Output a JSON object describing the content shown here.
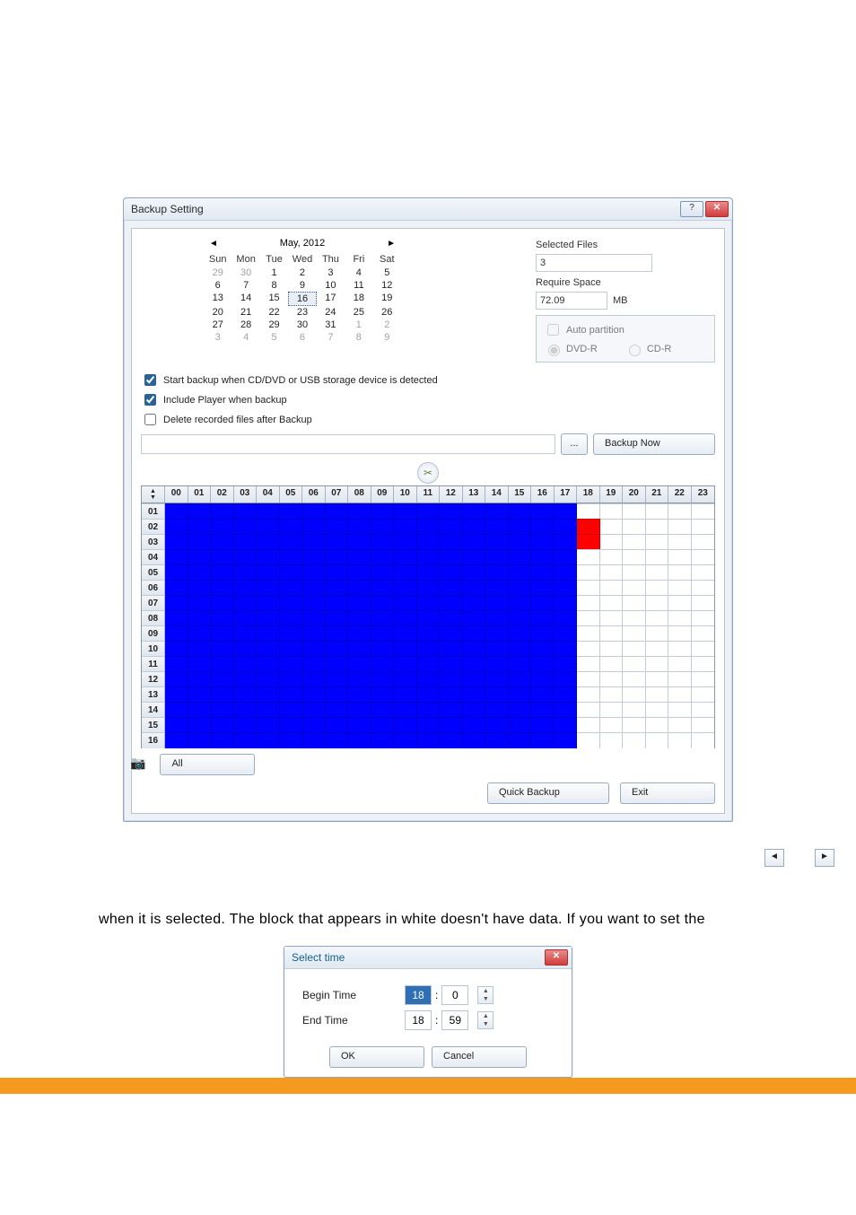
{
  "dialog": {
    "title": "Backup Setting",
    "calendar": {
      "month_label": "May, 2012",
      "dow": [
        "Sun",
        "Mon",
        "Tue",
        "Wed",
        "Thu",
        "Fri",
        "Sat"
      ],
      "weeks": [
        [
          {
            "d": "29",
            "g": true
          },
          {
            "d": "30",
            "g": true
          },
          {
            "d": "1"
          },
          {
            "d": "2"
          },
          {
            "d": "3"
          },
          {
            "d": "4"
          },
          {
            "d": "5"
          }
        ],
        [
          {
            "d": "6"
          },
          {
            "d": "7"
          },
          {
            "d": "8"
          },
          {
            "d": "9"
          },
          {
            "d": "10"
          },
          {
            "d": "11"
          },
          {
            "d": "12"
          }
        ],
        [
          {
            "d": "13"
          },
          {
            "d": "14"
          },
          {
            "d": "15"
          },
          {
            "d": "16",
            "sel": true
          },
          {
            "d": "17"
          },
          {
            "d": "18"
          },
          {
            "d": "19"
          }
        ],
        [
          {
            "d": "20"
          },
          {
            "d": "21"
          },
          {
            "d": "22"
          },
          {
            "d": "23"
          },
          {
            "d": "24"
          },
          {
            "d": "25"
          },
          {
            "d": "26"
          }
        ],
        [
          {
            "d": "27"
          },
          {
            "d": "28"
          },
          {
            "d": "29"
          },
          {
            "d": "30"
          },
          {
            "d": "31"
          },
          {
            "d": "1",
            "g": true
          },
          {
            "d": "2",
            "g": true
          }
        ],
        [
          {
            "d": "3",
            "g": true
          },
          {
            "d": "4",
            "g": true
          },
          {
            "d": "5",
            "g": true
          },
          {
            "d": "6",
            "g": true
          },
          {
            "d": "7",
            "g": true
          },
          {
            "d": "8",
            "g": true
          },
          {
            "d": "9",
            "g": true
          }
        ]
      ]
    },
    "right": {
      "selected_files_label": "Selected Files",
      "selected_files_value": "3",
      "require_space_label": "Require Space",
      "require_space_value": "72.09",
      "require_space_unit": "MB",
      "auto_partition_label": "Auto partition",
      "dvd_label": "DVD-R",
      "cd_label": "CD-R"
    },
    "checks": {
      "start_backup": "Start backup when CD/DVD or USB storage device is detected",
      "include_player": "Include Player when backup",
      "delete_after": "Delete recorded files after Backup"
    },
    "browse_btn": "...",
    "backup_now_btn": "Backup Now",
    "timeline": {
      "hours": [
        "00",
        "01",
        "02",
        "03",
        "04",
        "05",
        "06",
        "07",
        "08",
        "09",
        "10",
        "11",
        "12",
        "13",
        "14",
        "15",
        "16",
        "17",
        "18",
        "19",
        "20",
        "21",
        "22",
        "23"
      ],
      "rows": [
        "01",
        "02",
        "03",
        "04",
        "05",
        "06",
        "07",
        "08",
        "09",
        "10",
        "11",
        "12",
        "13",
        "14",
        "15",
        "16"
      ],
      "grid": [
        [
          "b",
          "b",
          "b",
          "b",
          "b",
          "b",
          "b",
          "b",
          "b",
          "b",
          "b",
          "b",
          "b",
          "b",
          "b",
          "b",
          "b",
          "b",
          "w",
          "w",
          "w",
          "w",
          "w",
          "w"
        ],
        [
          "b",
          "b",
          "b",
          "b",
          "b",
          "b",
          "b",
          "b",
          "b",
          "b",
          "b",
          "b",
          "b",
          "b",
          "b",
          "b",
          "b",
          "b",
          "r",
          "w",
          "w",
          "w",
          "w",
          "w"
        ],
        [
          "b",
          "b",
          "b",
          "b",
          "b",
          "b",
          "b",
          "b",
          "b",
          "b",
          "b",
          "b",
          "b",
          "b",
          "b",
          "b",
          "b",
          "b",
          "r",
          "w",
          "w",
          "w",
          "w",
          "w"
        ],
        [
          "b",
          "b",
          "b",
          "b",
          "b",
          "b",
          "b",
          "b",
          "b",
          "b",
          "b",
          "b",
          "b",
          "b",
          "b",
          "b",
          "b",
          "b",
          "w",
          "w",
          "w",
          "w",
          "w",
          "w"
        ],
        [
          "b",
          "b",
          "b",
          "b",
          "b",
          "b",
          "b",
          "b",
          "b",
          "b",
          "b",
          "b",
          "b",
          "b",
          "b",
          "b",
          "b",
          "b",
          "w",
          "w",
          "w",
          "w",
          "w",
          "w"
        ],
        [
          "b",
          "b",
          "b",
          "b",
          "b",
          "b",
          "b",
          "b",
          "b",
          "b",
          "b",
          "b",
          "b",
          "b",
          "b",
          "b",
          "b",
          "b",
          "w",
          "w",
          "w",
          "w",
          "w",
          "w"
        ],
        [
          "b",
          "b",
          "b",
          "b",
          "b",
          "b",
          "b",
          "b",
          "b",
          "b",
          "b",
          "b",
          "b",
          "b",
          "b",
          "b",
          "b",
          "b",
          "w",
          "w",
          "w",
          "w",
          "w",
          "w"
        ],
        [
          "b",
          "b",
          "b",
          "b",
          "b",
          "b",
          "b",
          "b",
          "b",
          "b",
          "b",
          "b",
          "b",
          "b",
          "b",
          "b",
          "b",
          "b",
          "w",
          "w",
          "w",
          "w",
          "w",
          "w"
        ],
        [
          "b",
          "b",
          "b",
          "b",
          "b",
          "b",
          "b",
          "b",
          "b",
          "b",
          "b",
          "b",
          "b",
          "b",
          "b",
          "b",
          "b",
          "b",
          "w",
          "w",
          "w",
          "w",
          "w",
          "w"
        ],
        [
          "b",
          "b",
          "b",
          "b",
          "b",
          "b",
          "b",
          "b",
          "b",
          "b",
          "b",
          "b",
          "b",
          "b",
          "b",
          "b",
          "b",
          "b",
          "w",
          "w",
          "w",
          "w",
          "w",
          "w"
        ],
        [
          "b",
          "b",
          "b",
          "b",
          "b",
          "b",
          "b",
          "b",
          "b",
          "b",
          "b",
          "b",
          "b",
          "b",
          "b",
          "b",
          "b",
          "b",
          "w",
          "w",
          "w",
          "w",
          "w",
          "w"
        ],
        [
          "b",
          "b",
          "b",
          "b",
          "b",
          "b",
          "b",
          "b",
          "b",
          "b",
          "b",
          "b",
          "b",
          "b",
          "b",
          "b",
          "b",
          "b",
          "w",
          "w",
          "w",
          "w",
          "w",
          "w"
        ],
        [
          "b",
          "b",
          "b",
          "b",
          "b",
          "b",
          "b",
          "b",
          "b",
          "b",
          "b",
          "b",
          "b",
          "b",
          "b",
          "b",
          "b",
          "b",
          "w",
          "w",
          "w",
          "w",
          "w",
          "w"
        ],
        [
          "b",
          "b",
          "b",
          "b",
          "b",
          "b",
          "b",
          "b",
          "b",
          "b",
          "b",
          "b",
          "b",
          "b",
          "b",
          "b",
          "b",
          "b",
          "w",
          "w",
          "w",
          "w",
          "w",
          "w"
        ],
        [
          "b",
          "b",
          "b",
          "b",
          "b",
          "b",
          "b",
          "b",
          "b",
          "b",
          "b",
          "b",
          "b",
          "b",
          "b",
          "b",
          "b",
          "b",
          "w",
          "w",
          "w",
          "w",
          "w",
          "w"
        ],
        [
          "b",
          "b",
          "b",
          "b",
          "b",
          "b",
          "b",
          "b",
          "b",
          "b",
          "b",
          "b",
          "b",
          "b",
          "b",
          "b",
          "b",
          "b",
          "w",
          "w",
          "w",
          "w",
          "w",
          "w"
        ]
      ]
    },
    "all_btn": "All",
    "quick_backup_btn": "Quick Backup",
    "exit_btn": "Exit"
  },
  "body_text": "when it is selected. The block that appears in white doesn't have data. If you want to set the",
  "select_time": {
    "title": "Select time",
    "begin_label": "Begin Time",
    "end_label": "End Time",
    "begin_h": "18",
    "begin_m": "0",
    "end_h": "18",
    "end_m": "59",
    "ok": "OK",
    "cancel": "Cancel"
  }
}
